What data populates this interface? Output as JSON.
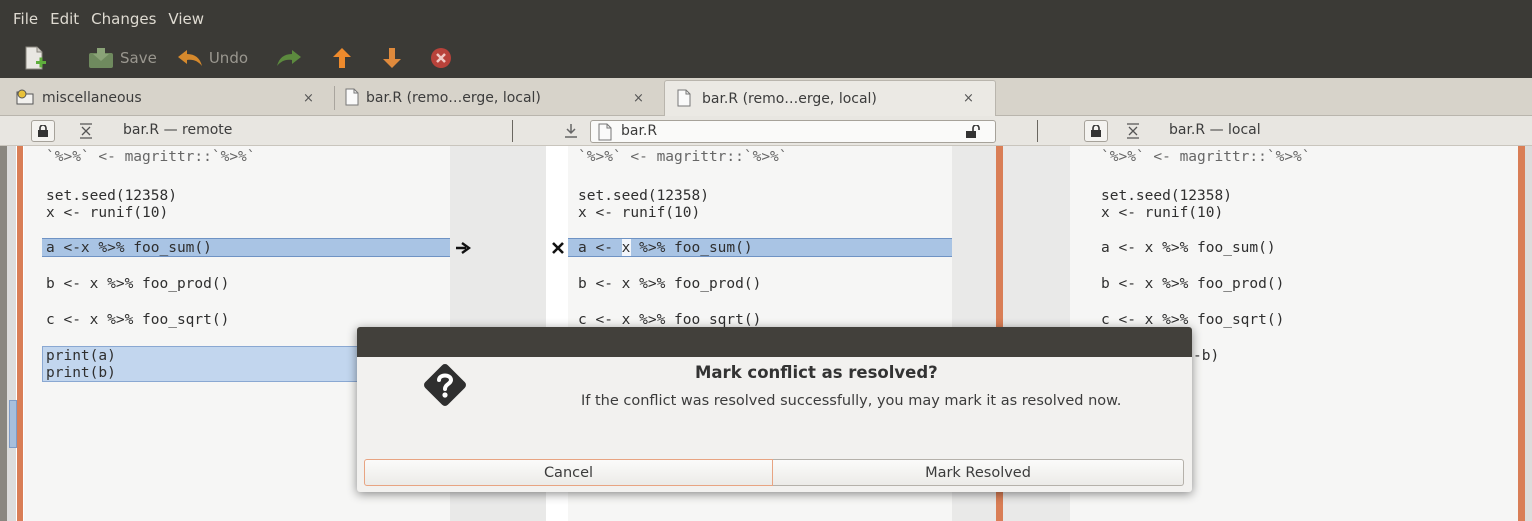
{
  "menu": [
    "File",
    "Edit",
    "Changes",
    "View"
  ],
  "toolbar": {
    "new_icon": "new-file-icon",
    "save_label": "Save",
    "undo_label": "Undo",
    "redo_icon": "redo-arrow-icon",
    "prev_icon": "up-arrow-icon",
    "next_icon": "down-arrow-icon",
    "stop_icon": "stop-icon"
  },
  "tabs": [
    {
      "label": "miscellaneous",
      "close": "×"
    },
    {
      "label": "bar.R (remo…erge, local)",
      "close": "×"
    },
    {
      "label": "bar.R (remo…erge, local)",
      "close": "×"
    }
  ],
  "panes": {
    "left_label": "bar.R — remote",
    "middle_file": "bar.R",
    "right_label": "bar.R — local"
  },
  "code": {
    "left": [
      "`%>%` <- magrittr::`%>%`",
      "set.seed(12358)",
      "x <- runif(10)",
      "a <-x %>% foo_sum()",
      "b <- x %>% foo_prod()",
      "c <- x %>% foo_sqrt()",
      "print(a)",
      "print(b)"
    ],
    "middle": [
      "`%>%` <- magrittr::`%>%`",
      "set.seed(12358)",
      "x <- runif(10)",
      "a <- x %>% foo_sum()",
      "b <- x %>% foo_prod()",
      "c <- x %>% foo sqrt()"
    ],
    "right": [
      "`%>%` <- magrittr::`%>%`",
      "set.seed(12358)",
      "x <- runif(10)",
      "a <- x %>% foo_sum()",
      "b <- x %>% foo_prod()",
      "c <- x %>% foo_sqrt()",
      "-b)"
    ]
  },
  "dialog": {
    "title": "Mark conflict as resolved?",
    "message": "If the conflict was resolved successfully, you may mark it as resolved now.",
    "cancel": "Cancel",
    "confirm": "Mark Resolved",
    "icon": "question-icon"
  },
  "colors": {
    "accent": "#d97e56",
    "highlight": "#a9c4e4",
    "dark_chrome": "#3b3a36"
  }
}
